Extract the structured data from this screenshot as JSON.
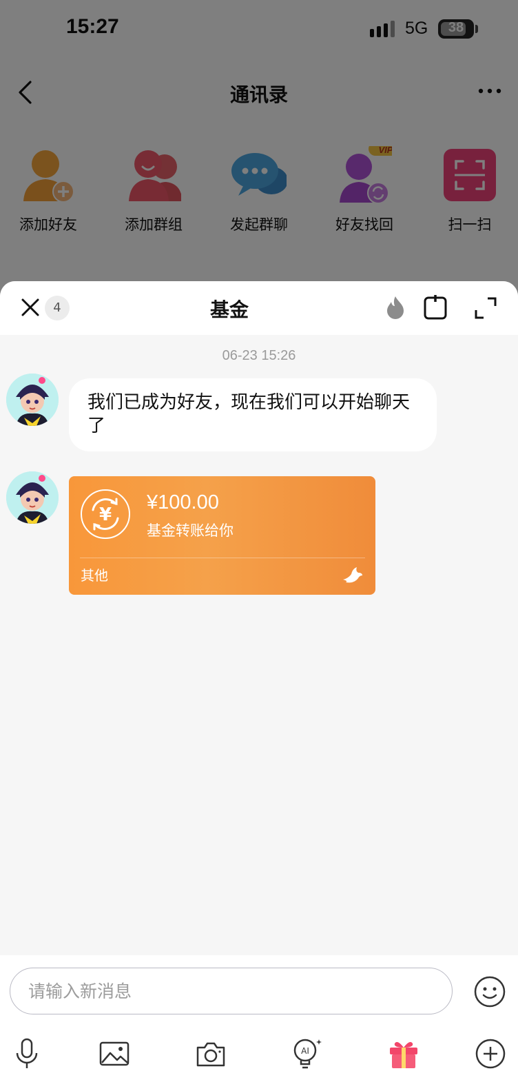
{
  "status_bar": {
    "time": "15:27",
    "network": "5G",
    "battery": "38"
  },
  "nav": {
    "title": "通讯录"
  },
  "quick_actions": [
    {
      "label": "添加好友",
      "icon": "add-friend-icon"
    },
    {
      "label": "添加群组",
      "icon": "add-group-icon"
    },
    {
      "label": "发起群聊",
      "icon": "start-group-chat-icon"
    },
    {
      "label": "好友找回",
      "icon": "friend-recovery-icon",
      "tag": "VIP"
    },
    {
      "label": "扫一扫",
      "icon": "scan-icon"
    }
  ],
  "chat": {
    "title": "基金",
    "unread_count": "4",
    "timestamp": "06-23 15:26",
    "messages": [
      {
        "type": "text",
        "text": "我们已成为好友，现在我们可以开始聊天了"
      },
      {
        "type": "transfer",
        "amount": "¥100.00",
        "description": "基金转账给你",
        "footer": "其他"
      }
    ]
  },
  "input": {
    "placeholder": "请输入新消息"
  },
  "toolbar": [
    "microphone-icon",
    "image-icon",
    "camera-icon",
    "ai-bulb-icon",
    "gift-icon",
    "plus-circle-icon"
  ],
  "colors": {
    "transfer_card": "#f8973a",
    "overlay": "rgba(0,0,0,0.5)",
    "gift": "#f2466a"
  }
}
